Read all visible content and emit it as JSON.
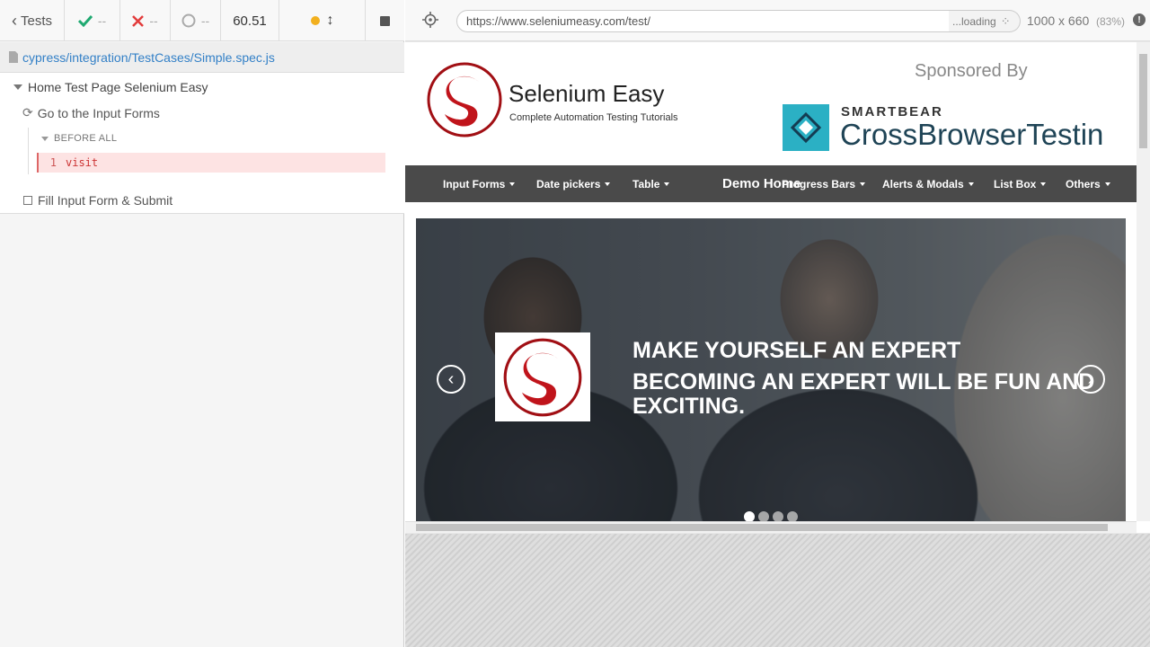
{
  "reporter": {
    "back_label": "Tests",
    "passed": "--",
    "failed": "--",
    "pending": "--",
    "duration": "60.51",
    "spec_path": "cypress/integration/TestCases/Simple.spec.js",
    "suite_title": "Home Test Page Selenium Easy",
    "test1_title": "Go to the Input Forms",
    "hook_title": "BEFORE ALL",
    "command": {
      "number": "1",
      "name": "visit"
    },
    "test2_title": "Fill Input Form & Submit"
  },
  "aut": {
    "url": "https://www.seleniumeasy.com/test/",
    "loading": "...loading",
    "viewport_size": "1000 x 660",
    "scale": "(83%)",
    "site": {
      "brand_title": "Selenium Easy",
      "brand_tagline": "Complete Automation Testing Tutorials",
      "sponsored_by": "Sponsored By",
      "sponsor_top": "SMARTBEAR",
      "sponsor_name": "CrossBrowserTestin",
      "nav": [
        "Input Forms",
        "Date pickers",
        "Table",
        "Demo Home",
        "Progress Bars",
        "Alerts & Modals",
        "List Box",
        "Others"
      ],
      "hero_line1": "MAKE YOURSELF AN EXPERT",
      "hero_line2": "BECOMING AN EXPERT WILL BE FUN AND EXCITING.",
      "slides_total": 4,
      "slide_active": 1
    }
  },
  "colors": {
    "pass": "#1fa971",
    "fail": "#e23c3c",
    "link": "#3380c7",
    "running": "#f2b01e",
    "nav_bg": "#4a4a4a",
    "brand_red": "#c0141b",
    "sponsor_teal": "#2bb0c4"
  }
}
